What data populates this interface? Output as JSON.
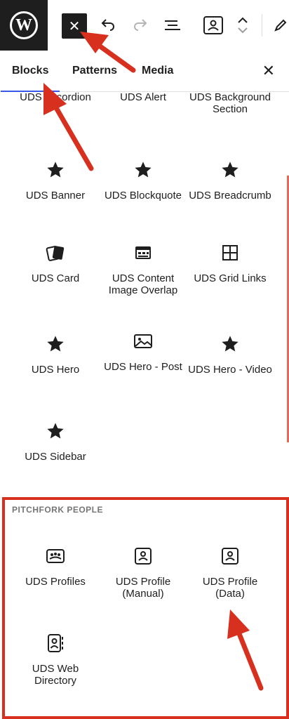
{
  "toolbar": {
    "logo_letter": "W",
    "close_glyph": "✕"
  },
  "tabs": [
    {
      "label": "Blocks"
    },
    {
      "label": "Patterns"
    },
    {
      "label": "Media"
    }
  ],
  "panel_close_glyph": "✕",
  "blocks": {
    "top_row": [
      "UDS Accordion",
      "UDS Alert",
      "UDS Background Section"
    ],
    "row2": [
      "UDS Banner",
      "UDS Blockquote",
      "UDS Breadcrumb"
    ],
    "row3": [
      "UDS Card",
      "UDS Content Image Overlap",
      "UDS Grid Links"
    ],
    "row4": [
      "UDS Hero",
      "UDS Hero - Post",
      "UDS Hero - Video"
    ],
    "row5": [
      "UDS Sidebar"
    ]
  },
  "section": {
    "title": "PITCHFORK PEOPLE",
    "items": [
      "UDS Profiles",
      "UDS Profile (Manual)",
      "UDS Profile (Data)",
      "UDS Web Directory"
    ]
  },
  "colors": {
    "highlight": "#d7301f",
    "active_tab": "#3858e9",
    "dark": "#1e1e1e"
  }
}
